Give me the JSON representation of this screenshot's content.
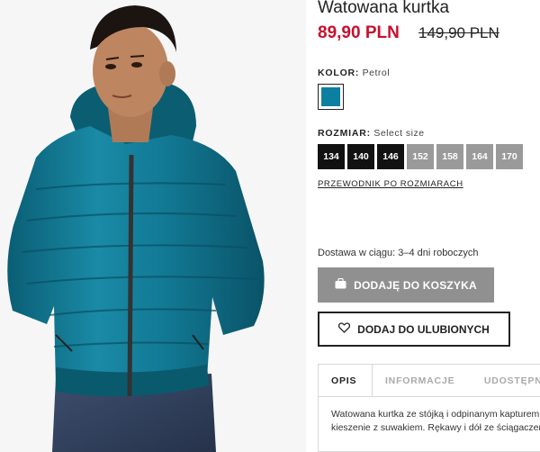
{
  "product": {
    "title": "Watowana kurtka",
    "price": "89,90 PLN",
    "old_price": "149,90 PLN"
  },
  "color": {
    "label": "KOLOR:",
    "value": "Petrol",
    "swatch_color": "#0d7fa0"
  },
  "size": {
    "label": "ROZMIAR:",
    "value": "Select size",
    "options": [
      {
        "label": "134",
        "available": true
      },
      {
        "label": "140",
        "available": true
      },
      {
        "label": "146",
        "available": true
      },
      {
        "label": "152",
        "available": false
      },
      {
        "label": "158",
        "available": false
      },
      {
        "label": "164",
        "available": false
      },
      {
        "label": "170",
        "available": false
      }
    ],
    "guide_link": "PRZEWODNIK PO ROZMIARACH"
  },
  "delivery": "Dostawa w ciągu: 3–4 dni roboczych",
  "buttons": {
    "add_to_cart": "DODAJĘ DO KOSZYKA",
    "add_to_favorites": "DODAJ DO ULUBIONYCH"
  },
  "tabs": {
    "items": [
      "OPIS",
      "INFORMACJE",
      "UDOSTĘPNIJ"
    ],
    "description_lines": [
      "Watowana kurtka ze stójką i odpinanym kapturem.",
      "kieszenie z suwakiem. Rękawy i dół ze ściągaczem."
    ]
  },
  "colors": {
    "price_red": "#c7102e",
    "jacket_teal": "#0d7fa0",
    "cart_button_gray": "#909090"
  },
  "icons": {
    "cart": "shopping-bag-icon",
    "favorite": "heart-icon"
  }
}
